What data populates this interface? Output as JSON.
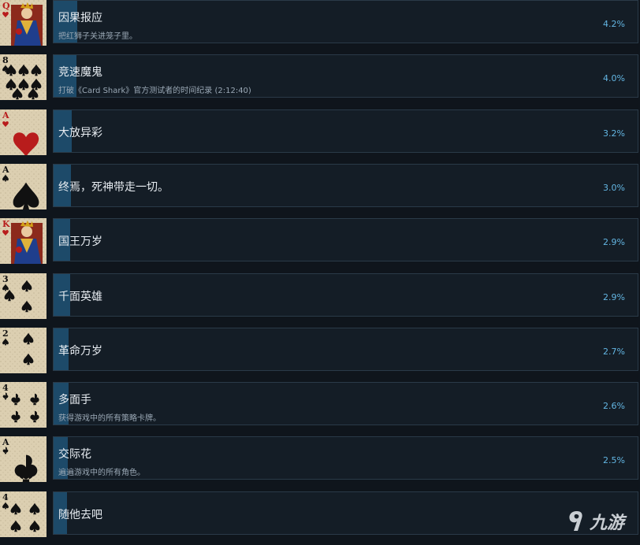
{
  "achievements": [
    {
      "card_rank": "Q",
      "card_suit": "heart",
      "card_kind": "face",
      "title": "因果报应",
      "desc": "把红狮子关进笼子里。",
      "pct": "4.2%",
      "pct_value": 0.042
    },
    {
      "card_rank": "8",
      "card_suit": "spade",
      "card_kind": "pips",
      "title": "竞速魔鬼",
      "desc": "打破《Card Shark》官方测试者的时间纪录 (2:12:40)",
      "pct": "4.0%",
      "pct_value": 0.04
    },
    {
      "card_rank": "A",
      "card_suit": "heart",
      "card_kind": "ace",
      "title": "大放异彩",
      "desc": "",
      "pct": "3.2%",
      "pct_value": 0.032
    },
    {
      "card_rank": "A",
      "card_suit": "spade",
      "card_kind": "ace",
      "title": "终焉，死神带走一切。",
      "desc": "",
      "pct": "3.0%",
      "pct_value": 0.03
    },
    {
      "card_rank": "K",
      "card_suit": "heart",
      "card_kind": "face",
      "title": "国王万岁",
      "desc": "",
      "pct": "2.9%",
      "pct_value": 0.029
    },
    {
      "card_rank": "3",
      "card_suit": "spade",
      "card_kind": "pips",
      "title": "千面英雄",
      "desc": "",
      "pct": "2.9%",
      "pct_value": 0.029
    },
    {
      "card_rank": "2",
      "card_suit": "spade",
      "card_kind": "pips",
      "title": "革命万岁",
      "desc": "",
      "pct": "2.7%",
      "pct_value": 0.027
    },
    {
      "card_rank": "4",
      "card_suit": "club",
      "card_kind": "pips",
      "title": "多面手",
      "desc": "获得游戏中的所有策略卡牌。",
      "pct": "2.6%",
      "pct_value": 0.026
    },
    {
      "card_rank": "A",
      "card_suit": "club",
      "card_kind": "ace",
      "title": "交际花",
      "desc": "遍遍游戏中的所有角色。",
      "pct": "2.5%",
      "pct_value": 0.025
    },
    {
      "card_rank": "4",
      "card_suit": "spade",
      "card_kind": "pips",
      "title": "随他去吧",
      "desc": "",
      "pct": "",
      "pct_value": 0.024
    }
  ],
  "watermark": {
    "text": "九游",
    "icon": "jiuyou-logo-icon"
  },
  "colors": {
    "bar": "#1d4a69",
    "pct": "#63b6e3",
    "bg": "#0f151c",
    "panel": "#141d26"
  }
}
